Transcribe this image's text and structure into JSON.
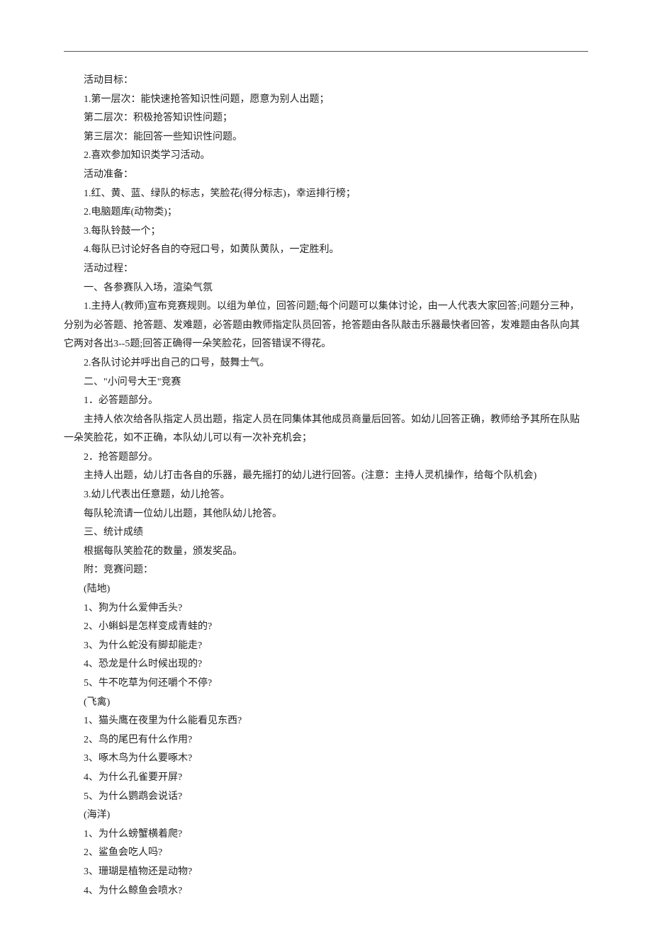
{
  "lines": [
    "活动目标：",
    "1.第一层次：能快速抢答知识性问题，愿意为别人出题；",
    "第二层次：积极抢答知识性问题；",
    "第三层次：能回答一些知识性问题。",
    "2.喜欢参加知识类学习活动。",
    "活动准备：",
    "1.红、黄、蓝、绿队的标志，笑脸花(得分标志)，幸运排行榜；",
    "2.电脑题库(动物类)；",
    "3.每队铃鼓一个；",
    "4.每队已讨论好各自的夺冠口号，如黄队黄队，一定胜利。",
    "活动过程：",
    "一、各参赛队入场，渲染气氛",
    "1.主持人(教师)宣布竞赛规则。以组为单位，回答问题;每个问题可以集体讨论，由一人代表大家回答;问题分三种，分别为必答题、抢答题、发难题，必答题由教师指定队员回答，抢答题由各队敲击乐器最快者回答，发难题由各队向其它两对各出3--5题;回答正确得一朵笑脸花，回答错误不得花。",
    "2.各队讨论并呼出自己的口号，鼓舞士气。",
    "二、\"小问号大王\"竞赛",
    "1．必答题部分。",
    "主持人依次给各队指定人员出题，指定人员在同集体其他成员商量后回答。如幼儿回答正确，教师给予其所在队贴一朵笑脸花，如不正确，本队幼儿可以有一次补充机会；",
    "2．抢答题部分。",
    "主持人出题，幼儿打击各自的乐器，最先摇打的幼儿进行回答。(注意：主持人灵机操作，给每个队机会)",
    "3.幼儿代表出任意题，幼儿抢答。",
    "每队轮流请一位幼儿出题，其他队幼儿抢答。",
    "三、统计成绩",
    "根据每队笑脸花的数量，颁发奖品。",
    "附：竞赛问题：",
    "(陆地)",
    "1、狗为什么爱伸舌头?",
    "2、小蝌蚪是怎样变成青蛙的?",
    "3、为什么蛇没有脚却能走?",
    "4、恐龙是什么时候出现的?",
    "5、牛不吃草为何还嚼个不停?",
    "(飞禽)",
    "1、猫头鹰在夜里为什么能看见东西?",
    "2、鸟的尾巴有什么作用?",
    "3、啄木鸟为什么要啄木?",
    "4、为什么孔雀要开屏?",
    "5、为什么鹦鹉会说话?",
    "(海洋)",
    "1、为什么螃蟹横着爬?",
    "2、鲨鱼会吃人吗?",
    "3、珊瑚是植物还是动物?",
    "4、为什么鲸鱼会喷水?"
  ],
  "longLines": [
    12,
    16
  ]
}
